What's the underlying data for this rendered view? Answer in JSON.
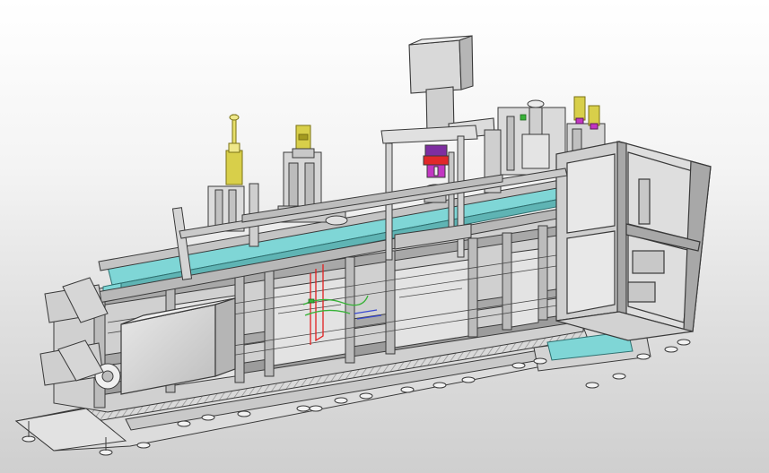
{
  "scene": {
    "subject": "",
    "colors": {
      "background_top": "#ffffff",
      "background_bottom": "#cfcfcf",
      "frame_fill": "#d8d8d8",
      "frame_dark": "#9a9a9a",
      "edge": "#3a3a3a",
      "panel_fill": "#e4e4e4",
      "conveyor_cyan": "#7fd6d6",
      "cylinder_yellow": "#d8cf4a",
      "cylinder_yellow_dark": "#a49a20",
      "gripper_magenta": "#c236c2",
      "gripper_red": "#e0282a",
      "wire_red": "#e21f1f",
      "wire_green": "#38b238",
      "wire_blue": "#3a4ad0"
    }
  }
}
